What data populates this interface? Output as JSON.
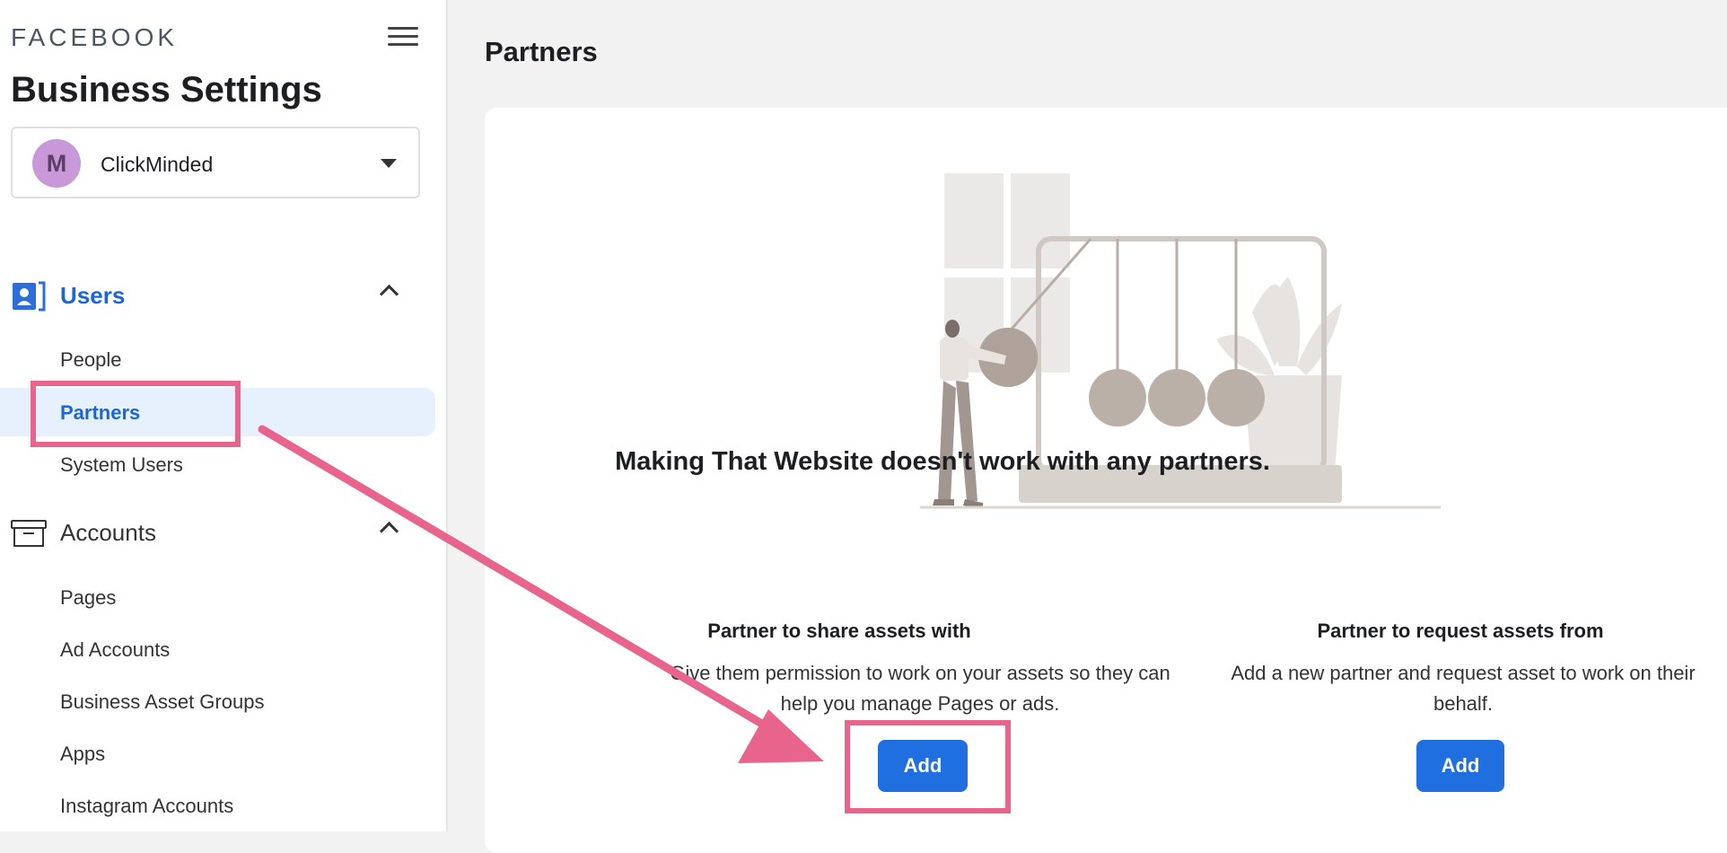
{
  "sidebar": {
    "brand": "FACEBOOK",
    "title": "Business Settings",
    "business": {
      "avatar_letter": "M",
      "name": "ClickMinded"
    },
    "sections": [
      {
        "label": "Users",
        "icon": "users-badge-icon",
        "expanded": true,
        "items": [
          {
            "label": "People"
          },
          {
            "label": "Partners",
            "active": true
          },
          {
            "label": "System Users"
          }
        ]
      },
      {
        "label": "Accounts",
        "icon": "archive-box-icon",
        "expanded": true,
        "items": [
          {
            "label": "Pages"
          },
          {
            "label": "Ad Accounts"
          },
          {
            "label": "Business Asset Groups"
          },
          {
            "label": "Apps"
          },
          {
            "label": "Instagram Accounts"
          }
        ]
      }
    ]
  },
  "main": {
    "page_title": "Partners",
    "empty_heading": "Making That Website doesn't work with any partners.",
    "share": {
      "title": "Partner to share assets with",
      "description": "Give them permission to work on your assets so they can help you manage Pages or ads.",
      "button": "Add"
    },
    "request": {
      "title": "Partner to request assets from",
      "description": "Add a new partner and request asset to work on their behalf.",
      "button": "Add"
    }
  },
  "colors": {
    "accent": "#1f6fe0",
    "highlight": "#e8648c",
    "active_bg": "#e7f0fd"
  }
}
